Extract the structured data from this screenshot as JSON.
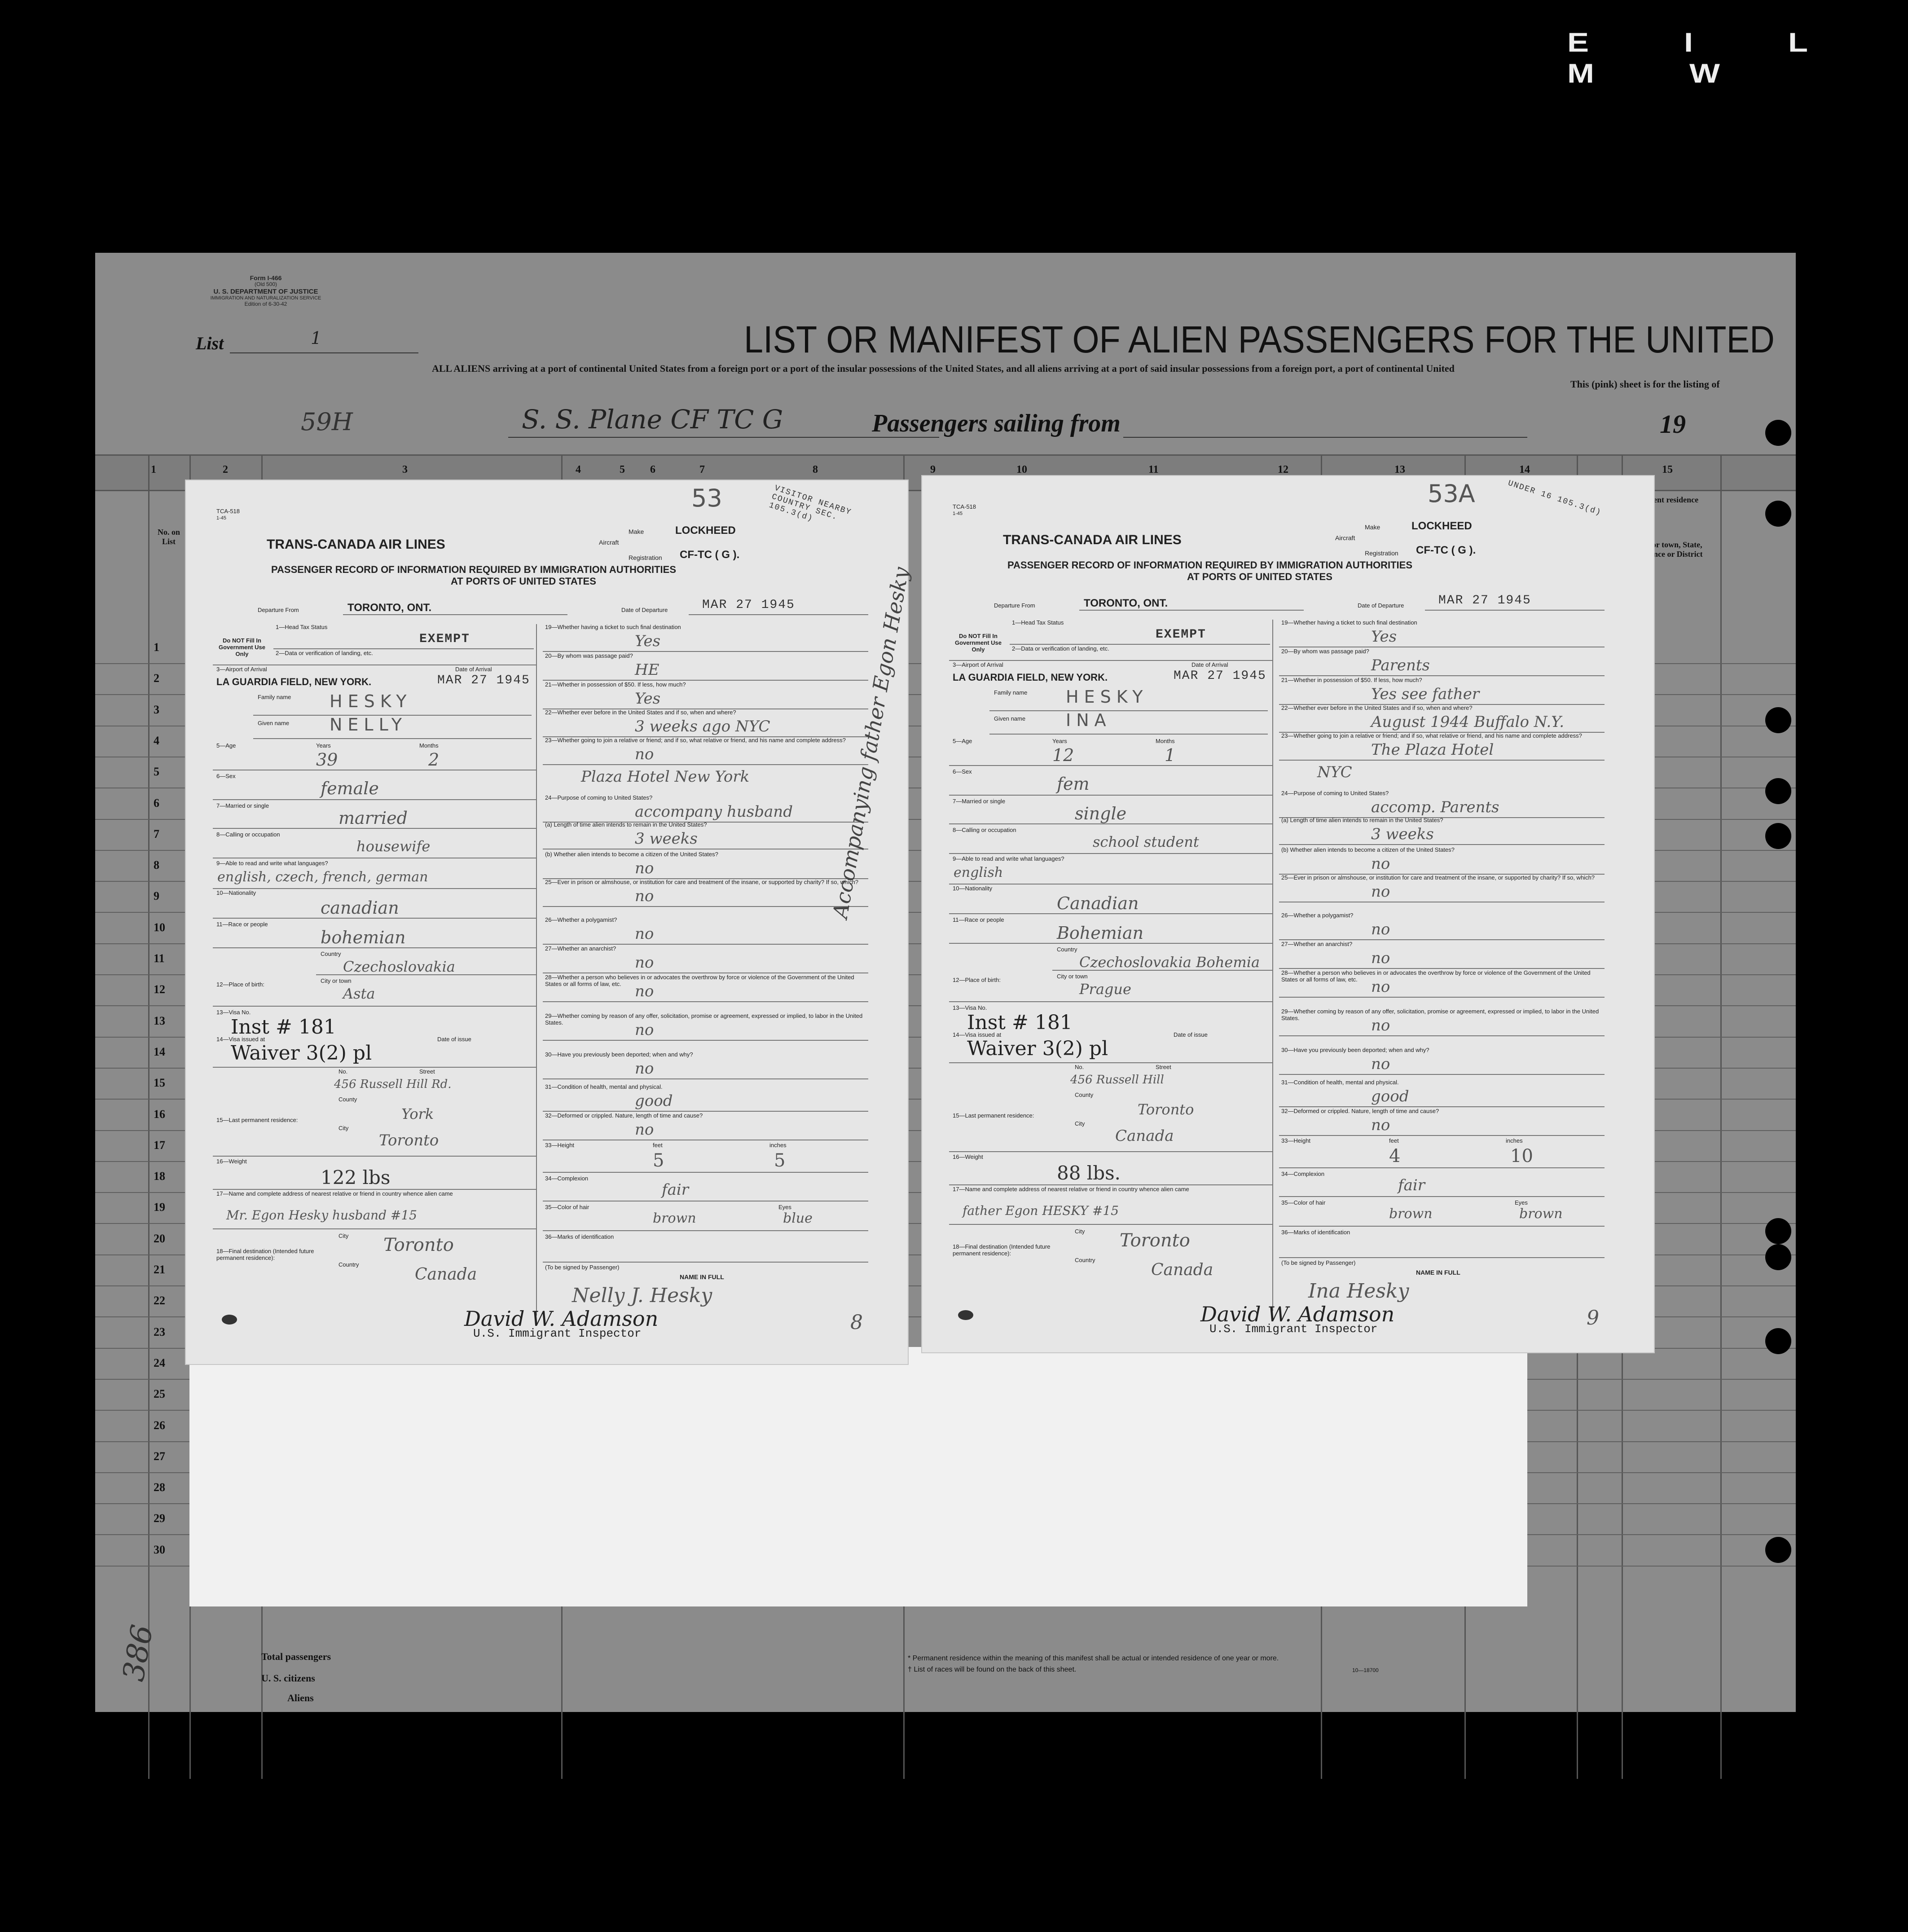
{
  "edge_letters": "E I L M W",
  "manifest": {
    "form_id": "Form I-466",
    "form_old": "(Old 500)",
    "department": "U. S. DEPARTMENT OF JUSTICE",
    "service": "IMMIGRATION AND NATURALIZATION SERVICE",
    "edition": "Edition of 6-30-42",
    "list_label": "List",
    "list_value": "1",
    "sheet_number": "59H",
    "title": "LIST OR MANIFEST OF ALIEN PASSENGERS FOR THE UNITED",
    "subtitle_line1": "ALL ALIENS arriving at a port of continental United States from a foreign port or a port of the insular possessions of the United States, and all aliens arriving at a port of said insular possessions from a foreign port, a port of continental United",
    "subtitle_line2": "This (pink) sheet is for the listing of",
    "ship_handwritten": "S. S. Plane CF TC G",
    "sailing_label": "Passengers sailing from",
    "year_prefix": "19",
    "col_numbers": [
      "1",
      "2",
      "3",
      "4",
      "5",
      "6",
      "7",
      "8",
      "9",
      "10",
      "11",
      "12",
      "13",
      "14",
      "15"
    ],
    "col_no_label": "No. on List",
    "col_residence": "Permanent residence",
    "col_city": "City or town, State, Province or District",
    "row_numbers": [
      "1",
      "2",
      "3",
      "4",
      "5",
      "6",
      "7",
      "8",
      "9",
      "10",
      "11",
      "12",
      "13",
      "14",
      "15",
      "16",
      "17",
      "18",
      "19",
      "20",
      "21",
      "22",
      "23",
      "24",
      "25",
      "26",
      "27",
      "28",
      "29",
      "30"
    ],
    "total_passengers": "Total passengers",
    "us_citizens": "U. S. citizens",
    "aliens": "Aliens",
    "handwritten_corner": "386",
    "footnote1": "* Permanent residence within the meaning of this manifest shall be actual or intended residence of one year or more.",
    "footnote2": "† List of races will be found on the back of this sheet.",
    "form_code": "10—18700"
  },
  "cards": [
    {
      "form_code": "TCA-518",
      "form_date": "1-45",
      "airline": "TRANS-CANADA AIR LINES",
      "record_title": "PASSENGER RECORD OF INFORMATION REQUIRED BY IMMIGRATION AUTHORITIES",
      "record_sub": "AT PORTS OF UNITED STATES",
      "aircraft_label": "Aircraft",
      "make_label": "Make",
      "make": "LOCKHEED",
      "registration_label": "Registration",
      "registration": "CF-TC ( G ).",
      "departure_label": "Departure From",
      "departure": "TORONTO, ONT.",
      "date_departure_label": "Date of Departure",
      "date_departure": "MAR 27 1945",
      "page_no": "53",
      "stamp": "VISITOR NEARBY COUNTRY SEC. 105.3(d)",
      "do_not_fill": "Do NOT Fill In Government Use Only",
      "f1": "1—Head Tax Status",
      "head_tax": "EXEMPT",
      "f2": "2—Data or verification of landing, etc.",
      "f3": "3—Airport of Arrival",
      "date_arrival_label": "Date of Arrival",
      "airport": "LA GUARDIA FIELD, NEW YORK.",
      "date_arrival": "MAR 27 1945",
      "family_name_label": "Family name",
      "family_name": "HESKY",
      "given_name_label": "Given name",
      "given_name": "NELLY",
      "f5": "5—Age",
      "years_label": "Years",
      "months_label": "Months",
      "age_years": "39",
      "age_months": "2",
      "f6": "6—Sex",
      "sex": "female",
      "f7": "7—Married or single",
      "married": "married",
      "f8": "8—Calling or occupation",
      "occupation": "housewife",
      "f9": "9—Able to read and write what languages?",
      "languages": "english, czech, french, german",
      "f10": "10—Nationality",
      "nationality": "canadian",
      "f11": "11—Race or people",
      "race": "bohemian",
      "f12": "12—Place of birth:",
      "country_label": "Country",
      "birth_country": "Czechoslovakia",
      "city_label": "City or town",
      "birth_city": "Asta",
      "f13": "13—Visa No.",
      "visa_no": "Inst # 181",
      "f14": "14—Visa issued at",
      "date_issue_label": "Date of issue",
      "visa_issued": "Waiver 3(2) pl",
      "f15": "15—Last permanent residence:",
      "no_label": "No.",
      "street_label": "Street",
      "street": "456 Russell Hill Rd.",
      "county_label": "County",
      "county": "York",
      "res_city_label": "City",
      "res_city": "Toronto",
      "f16": "16—Weight",
      "weight": "122 lbs",
      "f17": "17—Name and complete address of nearest relative or friend in country whence alien came",
      "relative": "Mr. Egon Hesky husband #15",
      "f18": "18—Final destination (Intended future permanent residence):",
      "dest_city_label": "City",
      "dest_city": "Toronto",
      "dest_country_label": "Country",
      "dest_country": "Canada",
      "f19": "19—Whether having a ticket to such final destination",
      "a19": "Yes",
      "f20": "20—By whom was passage paid?",
      "a20": "HE",
      "f21": "21—Whether in possession of $50. If less, how much?",
      "a21": "Yes",
      "f22": "22—Whether ever before in the United States and if so, when and where?",
      "a22": "3 weeks ago NYC",
      "f23": "23—Whether going to join a relative or friend; and if so, what relative or friend, and his name and complete address?",
      "a23a": "no",
      "a23b": "Plaza Hotel New York",
      "f24": "24—Purpose of coming to United States?",
      "a24": "accompany husband",
      "f24a": "(a) Length of time alien intends to remain in the United States?",
      "a24a": "3 weeks",
      "f24b": "(b) Whether alien intends to become a citizen of the United States?",
      "a24b": "no",
      "f25": "25—Ever in prison or almshouse, or institution for care and treatment of the insane, or supported by charity? If so, which?",
      "a25": "no",
      "f26": "26—Whether a polygamist?",
      "a26": "no",
      "f27": "27—Whether an anarchist?",
      "a27": "no",
      "f28": "28—Whether a person who believes in or advocates the overthrow by force or violence of the Government of the United States or all forms of law, etc.",
      "a28": "no",
      "f29": "29—Whether coming by reason of any offer, solicitation, promise or agreement, expressed or implied, to labor in the United States.",
      "a29": "no",
      "f30": "30—Have you previously been deported; when and why?",
      "a30": "no",
      "f31": "31—Condition of health, mental and physical.",
      "a31": "good",
      "f32": "32—Deformed or crippled. Nature, length of time and cause?",
      "a32": "no",
      "f33": "33—Height",
      "feet_label": "feet",
      "inches_label": "inches",
      "height_feet": "5",
      "height_inches": "5",
      "f34": "34—Complexion",
      "a34": "fair",
      "f35": "35—Color of hair",
      "eyes_label": "Eyes",
      "hair": "brown",
      "eyes": "blue",
      "f36": "36—Marks of identification",
      "sign_label": "(To be signed by Passenger)",
      "name_in_full": "NAME IN FULL",
      "passenger_signature": "Nelly J. Hesky",
      "inspector_signature": "David W. Adamson",
      "inspector_title": "U.S. Immigrant Inspector",
      "card_no": "8",
      "side_note": ""
    },
    {
      "form_code": "TCA-518",
      "form_date": "1-45",
      "airline": "TRANS-CANADA AIR LINES",
      "record_title": "PASSENGER RECORD OF INFORMATION REQUIRED BY IMMIGRATION AUTHORITIES",
      "record_sub": "AT PORTS OF UNITED STATES",
      "aircraft_label": "Aircraft",
      "make_label": "Make",
      "make": "LOCKHEED",
      "registration_label": "Registration",
      "registration": "CF-TC ( G ).",
      "departure_label": "Departure From",
      "departure": "TORONTO, ONT.",
      "date_departure_label": "Date of Departure",
      "date_departure": "MAR 27 1945",
      "page_no": "53A",
      "stamp": "UNDER 16 105.3(d)",
      "do_not_fill": "Do NOT Fill In Government Use Only",
      "f1": "1—Head Tax Status",
      "head_tax": "EXEMPT",
      "f2": "2—Data or verification of landing, etc.",
      "f3": "3—Airport of Arrival",
      "date_arrival_label": "Date of Arrival",
      "airport": "LA GUARDIA FIELD, NEW YORK.",
      "date_arrival": "MAR 27 1945",
      "family_name_label": "Family name",
      "family_name": "HESKY",
      "given_name_label": "Given name",
      "given_name": "INA",
      "f5": "5—Age",
      "years_label": "Years",
      "months_label": "Months",
      "age_years": "12",
      "age_months": "1",
      "f6": "6—Sex",
      "sex": "fem",
      "f7": "7—Married or single",
      "married": "single",
      "f8": "8—Calling or occupation",
      "occupation": "school student",
      "f9": "9—Able to read and write what languages?",
      "languages": "english",
      "f10": "10—Nationality",
      "nationality": "Canadian",
      "f11": "11—Race or people",
      "race": "Bohemian",
      "f12": "12—Place of birth:",
      "country_label": "Country",
      "birth_country": "Czechoslovakia Bohemia",
      "city_label": "City or town",
      "birth_city": "Prague",
      "f13": "13—Visa No.",
      "visa_no": "Inst # 181",
      "f14": "14—Visa issued at",
      "date_issue_label": "Date of issue",
      "visa_issued": "Waiver 3(2) pl",
      "f15": "15—Last permanent residence:",
      "no_label": "No.",
      "street_label": "Street",
      "street": "456 Russell Hill",
      "county_label": "County",
      "county": "Toronto",
      "res_city_label": "City",
      "res_city": "Canada",
      "f16": "16—Weight",
      "weight": "88 lbs.",
      "f17": "17—Name and complete address of nearest relative or friend in country whence alien came",
      "relative": "father Egon HESKY #15",
      "f18": "18—Final destination (Intended future permanent residence):",
      "dest_city_label": "City",
      "dest_city": "Toronto",
      "dest_country_label": "Country",
      "dest_country": "Canada",
      "f19": "19—Whether having a ticket to such final destination",
      "a19": "Yes",
      "f20": "20—By whom was passage paid?",
      "a20": "Parents",
      "f21": "21—Whether in possession of $50. If less, how much?",
      "a21": "Yes see father",
      "f22": "22—Whether ever before in the United States and if so, when and where?",
      "a22": "August 1944 Buffalo N.Y.",
      "f23": "23—Whether going to join a relative or friend; and if so, what relative or friend, and his name and complete address?",
      "a23a": "The Plaza Hotel",
      "a23b": "NYC",
      "f24": "24—Purpose of coming to United States?",
      "a24": "accomp. Parents",
      "f24a": "(a) Length of time alien intends to remain in the United States?",
      "a24a": "3 weeks",
      "f24b": "(b) Whether alien intends to become a citizen of the United States?",
      "a24b": "no",
      "f25": "25—Ever in prison or almshouse, or institution for care and treatment of the insane, or supported by charity? If so, which?",
      "a25": "no",
      "f26": "26—Whether a polygamist?",
      "a26": "no",
      "f27": "27—Whether an anarchist?",
      "a27": "no",
      "f28": "28—Whether a person who believes in or advocates the overthrow by force or violence of the Government of the United States or all forms of law, etc.",
      "a28": "no",
      "f29": "29—Whether coming by reason of any offer, solicitation, promise or agreement, expressed or implied, to labor in the United States.",
      "a29": "no",
      "f30": "30—Have you previously been deported; when and why?",
      "a30": "no",
      "f31": "31—Condition of health, mental and physical.",
      "a31": "good",
      "f32": "32—Deformed or crippled. Nature, length of time and cause?",
      "a32": "no",
      "f33": "33—Height",
      "feet_label": "feet",
      "inches_label": "inches",
      "height_feet": "4",
      "height_inches": "10",
      "f34": "34—Complexion",
      "a34": "fair",
      "f35": "35—Color of hair",
      "eyes_label": "Eyes",
      "hair": "brown",
      "eyes": "brown",
      "f36": "36—Marks of identification",
      "sign_label": "(To be signed by Passenger)",
      "name_in_full": "NAME IN FULL",
      "passenger_signature": "Ina Hesky",
      "inspector_signature": "David W. Adamson",
      "inspector_title": "U.S. Immigrant Inspector",
      "card_no": "9",
      "side_note": "Accompanying father Egon Hesky"
    }
  ]
}
